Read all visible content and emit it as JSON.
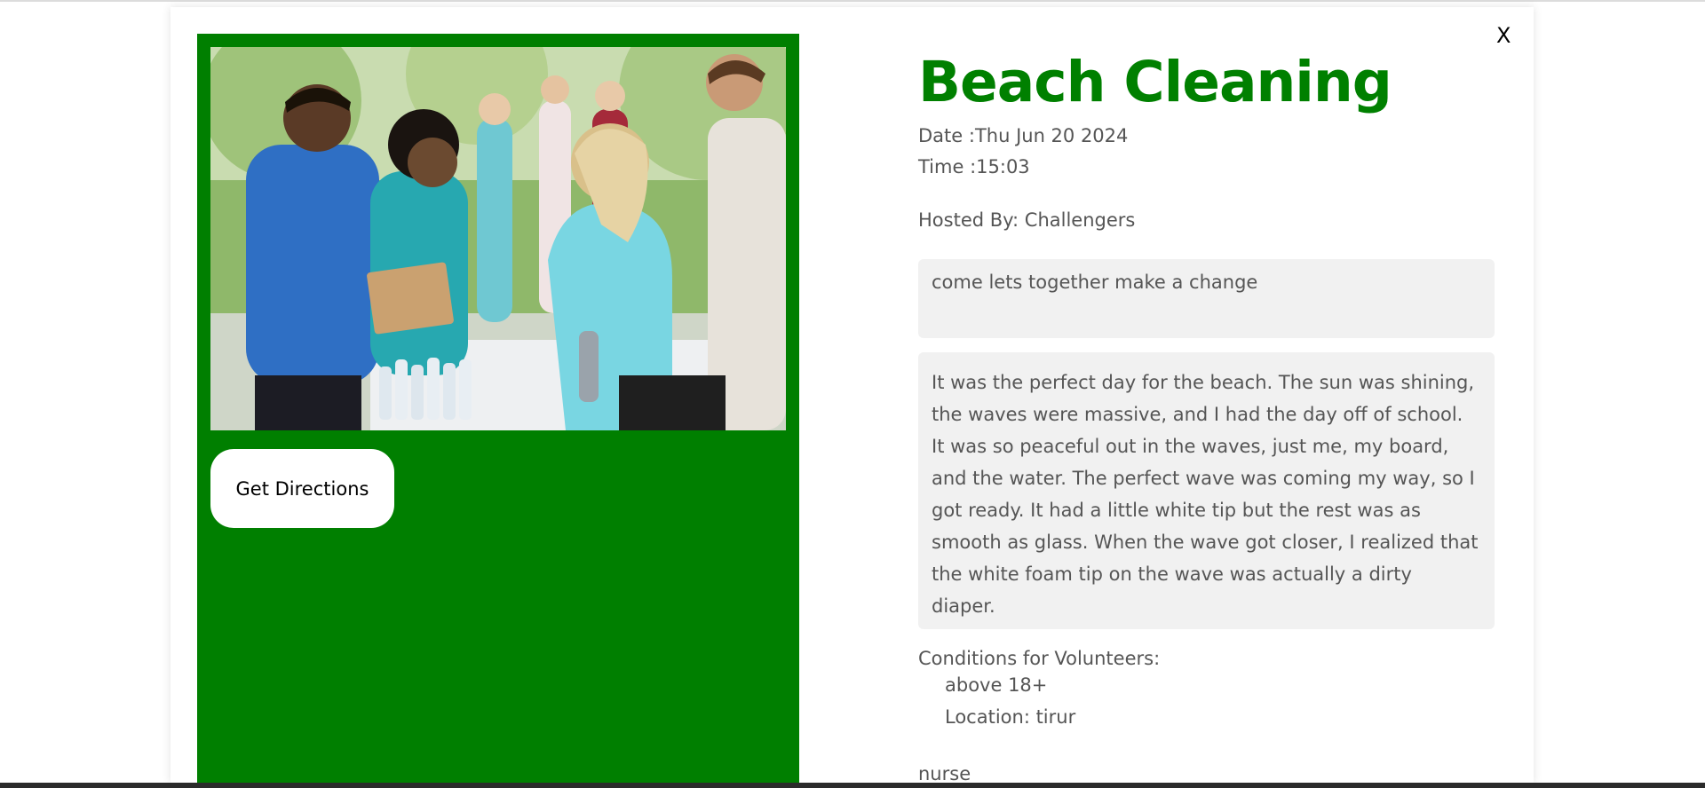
{
  "modal": {
    "close_label": "X",
    "left_panel": {
      "image_alt": "volunteers at registration table",
      "directions_label": "Get Directions"
    },
    "event": {
      "title": "Beach Cleaning",
      "date": "Date :Thu Jun 20 2024",
      "time": "Time :15:03",
      "hosted_by": "Hosted By: Challengers",
      "tagline": "come lets together make a change",
      "description": "It was the perfect day for the beach. The sun was shining, the waves were massive, and I had the day off of school. It was so peaceful out in the waves, just me, my board, and the water. The perfect wave was coming my way, so I got ready. It had a little white tip but the rest was as smooth as glass. When the wave got closer, I realized that the white foam tip on the wave was actually a dirty diaper.",
      "conditions_heading": "Conditions for Volunteers:",
      "conditions": [
        "above 18+",
        "Location: tirur"
      ],
      "extra": "nurse"
    }
  },
  "colors": {
    "accent_green": "#008000",
    "panel_green": "#007f00",
    "box_bg": "#f1f1f1",
    "text": "#555555"
  }
}
